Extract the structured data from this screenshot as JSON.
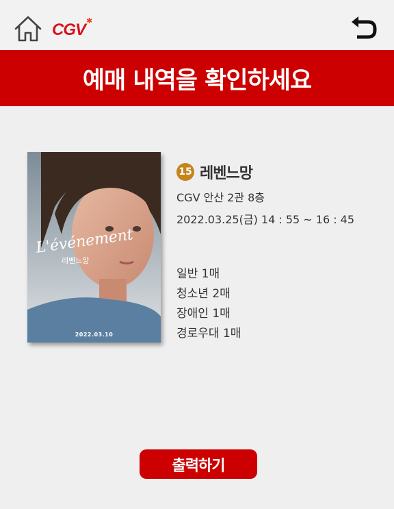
{
  "header": {
    "logo_text": "CGV",
    "logo_star": "✱",
    "home_icon": "home-icon",
    "back_icon": "back-arrow-icon"
  },
  "banner": {
    "title": "예매 내역을 확인하세요"
  },
  "poster": {
    "script_title": "L'événement",
    "korean_title": "레벤느망",
    "release_date": "2022.03.10"
  },
  "movie": {
    "rating": "15",
    "title": "레벤느망",
    "theater": "CGV 안산 2관 8층",
    "showtime": "2022.03.25(금)  14 : 55 ~ 16 : 45"
  },
  "tickets": [
    {
      "label": "일반 1매"
    },
    {
      "label": "청소년 2매"
    },
    {
      "label": "장애인 1매"
    },
    {
      "label": "경로우대 1매"
    }
  ],
  "actions": {
    "print_label": "출력하기"
  },
  "colors": {
    "brand_red": "#cc0000",
    "rating_gold": "#c5841c"
  }
}
